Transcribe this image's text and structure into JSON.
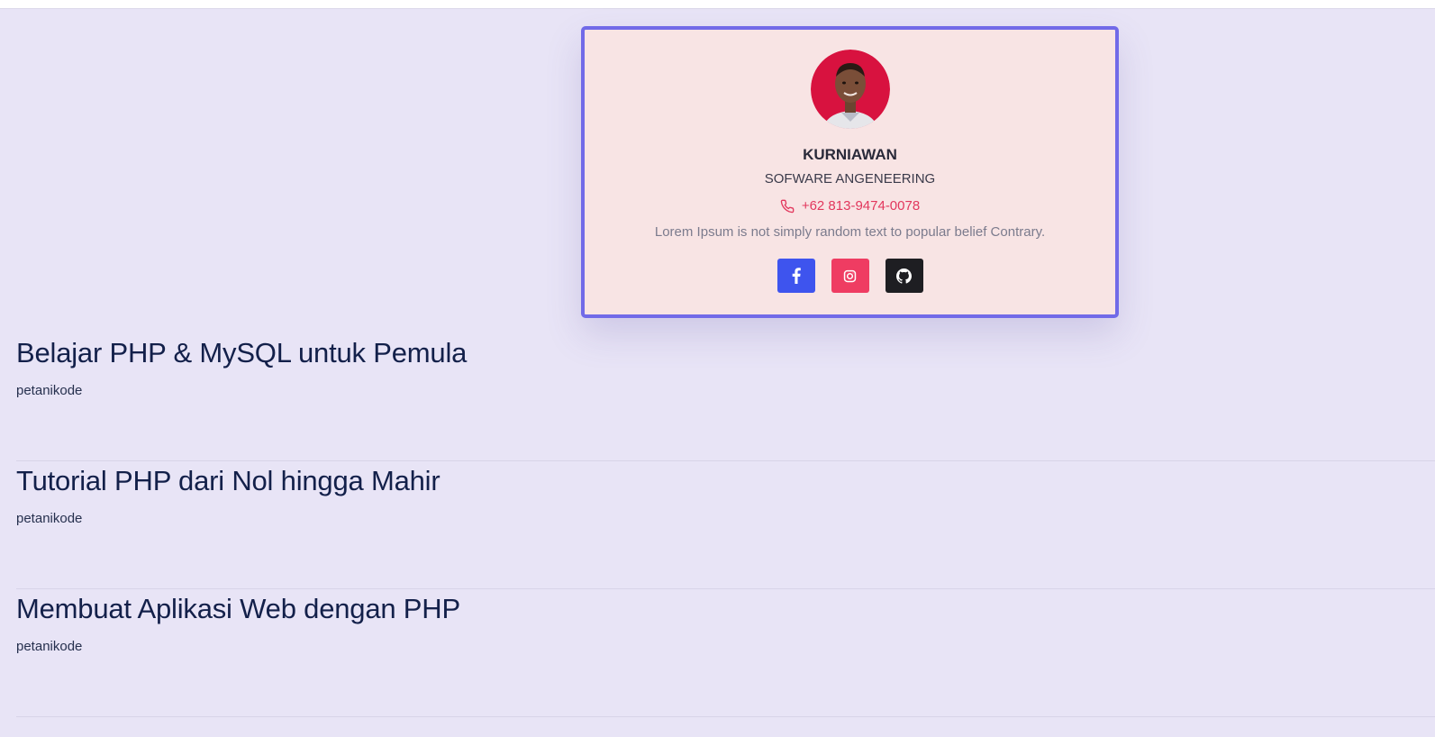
{
  "profile": {
    "name": "KURNIAWAN",
    "role": "SOFWARE ANGENEERING",
    "phone": "+62 813-9474-0078",
    "bio": "Lorem Ipsum is not simply random text to popular belief Contrary.",
    "accent_color": "#716ae8",
    "card_background": "#f8e4e4",
    "phone_color": "#e2375d",
    "socials": [
      {
        "network": "facebook",
        "icon": "facebook-icon",
        "color": "#3e54ee"
      },
      {
        "network": "instagram",
        "icon": "instagram-icon",
        "color": "#ef3c62"
      },
      {
        "network": "github",
        "icon": "github-icon",
        "color": "#1e1e22"
      }
    ]
  },
  "posts": [
    {
      "title": "Belajar PHP & MySQL untuk Pemula",
      "author": "petanikode"
    },
    {
      "title": "Tutorial PHP dari Nol hingga Mahir",
      "author": "petanikode"
    },
    {
      "title": "Membuat Aplikasi Web dengan PHP",
      "author": "petanikode"
    }
  ],
  "page_background": "#e8e4f6"
}
